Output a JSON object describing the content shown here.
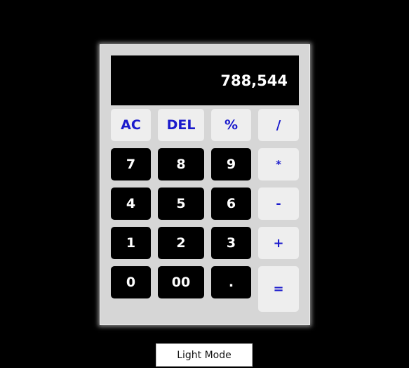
{
  "calculator": {
    "display_value": "788,544",
    "keys": {
      "ac": "AC",
      "del": "DEL",
      "percent": "%",
      "divide": "/",
      "seven": "7",
      "eight": "8",
      "nine": "9",
      "multiply": "*",
      "four": "4",
      "five": "5",
      "six": "6",
      "minus": "-",
      "one": "1",
      "two": "2",
      "three": "3",
      "plus": "+",
      "zero": "0",
      "double_zero": "00",
      "decimal": ".",
      "equals": "="
    }
  },
  "mode_toggle": {
    "label": "Light Mode"
  },
  "colors": {
    "page_background": "#000000",
    "calculator_body": "#d6d6d6",
    "display_background": "#000000",
    "display_text": "#ffffff",
    "number_key_background": "#000000",
    "number_key_text": "#ffffff",
    "function_key_background": "#eeeeee",
    "function_key_text": "#1a1acc"
  }
}
